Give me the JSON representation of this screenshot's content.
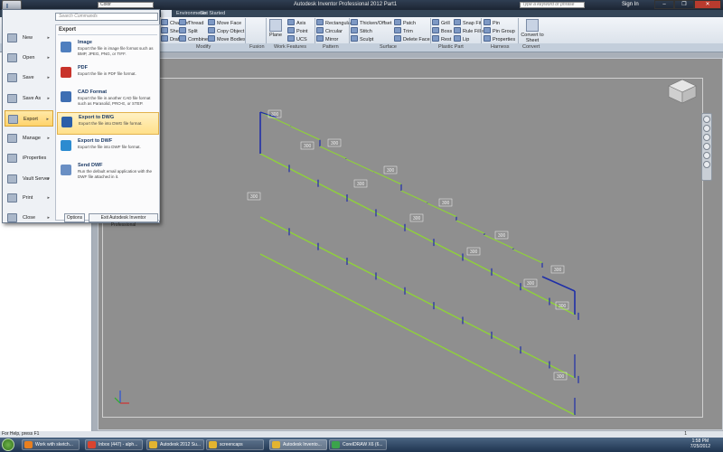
{
  "window": {
    "title": "Autodesk Inventor Professional 2012   Part1",
    "quick_access_combo": "Color",
    "search_placeholder": "Type a keyword or phrase",
    "sign_in": "Sign In"
  },
  "tabs": [
    {
      "label": "Environments"
    },
    {
      "label": "Get Started"
    }
  ],
  "ribbon": {
    "modify_tools": [
      "Chamfer",
      "Shell",
      "Draft",
      "Thread",
      "Split",
      "Combine",
      "Move Face",
      "Copy Object",
      "Move Bodies"
    ],
    "work_features": {
      "plane": "Plane",
      "axis": "Axis",
      "point": "Point",
      "ucs": "UCS"
    },
    "pattern_tools": [
      "Rectangular",
      "Circular",
      "Mirror"
    ],
    "surface_tools": [
      "Thicken/Offset",
      "Stitch",
      "Sculpt",
      "Patch",
      "Trim",
      "Delete Face"
    ],
    "plastic_tools": [
      "Grill",
      "Boss",
      "Rest",
      "Snap Fit",
      "Rule Fillet",
      "Lip"
    ],
    "harness_tools": [
      "Pin",
      "Pin Group",
      "Properties"
    ],
    "convert_tool": "Convert to Sheet Metal",
    "panels": [
      "Modify",
      "Fusion",
      "Work Features",
      "Pattern",
      "Surface",
      "Plastic Part",
      "Harness",
      "Convert"
    ]
  },
  "app_menu": {
    "search_placeholder": "Search Commands",
    "items": [
      {
        "label": "New",
        "arrow": "▸"
      },
      {
        "label": "Open",
        "arrow": "▸"
      },
      {
        "label": "Save",
        "arrow": "▸"
      },
      {
        "label": "Save As",
        "arrow": "▸"
      },
      {
        "label": "Export",
        "arrow": "▸"
      },
      {
        "label": "Manage",
        "arrow": "▸"
      },
      {
        "label": "iProperties",
        "arrow": ""
      },
      {
        "label": "Vault Server",
        "arrow": "▸"
      },
      {
        "label": "Print",
        "arrow": "▸"
      },
      {
        "label": "Close",
        "arrow": "▸"
      }
    ],
    "export_header": "Export",
    "export_items": [
      {
        "title": "Image",
        "desc": "Export the file in image file format such as BMP, JPEG, PNG, or TIFF.",
        "color": "#4f7fbf"
      },
      {
        "title": "PDF",
        "desc": "Export the file in PDF file format.",
        "color": "#c8332b"
      },
      {
        "title": "CAD Format",
        "desc": "Export the file in another CAD file format such as Parasolid, PRO-E, or STEP.",
        "color": "#3f6fb3"
      },
      {
        "title": "Export to DWG",
        "desc": "Export the file into DWG file format.",
        "color": "#2b5fa8"
      },
      {
        "title": "Export to DWF",
        "desc": "Export the file into DWF file format.",
        "color": "#2d8bd0"
      },
      {
        "title": "Send DWF",
        "desc": "Run the default email application with the DWF file attached in it.",
        "color": "#6a8fc4"
      }
    ],
    "options_label": "Options",
    "exit_label": "Exit Autodesk Inventor Professional"
  },
  "drawing": {
    "dims": [
      "300",
      "300",
      "300",
      "300",
      "300",
      "300",
      "300",
      "300",
      "300",
      "300",
      "300",
      "300",
      "300",
      "300",
      "300",
      "300",
      "300"
    ],
    "colors": {
      "green": "#8fd13a",
      "blue": "#1f2fa8",
      "dim": "#f2f2f2"
    }
  },
  "status": {
    "help": "For Help, press F1",
    "count": "1"
  },
  "taskbar": {
    "items": [
      {
        "label": "Work with sketch...",
        "color": "#e87f1f"
      },
      {
        "label": "Inbox (447) - alph...",
        "color": "#d9442f"
      },
      {
        "label": "Autodesk 2012 Su...",
        "color": "#e3b430"
      },
      {
        "label": "screencaps",
        "color": "#e3b430"
      },
      {
        "label": "Autodesk Invento...",
        "color": "#e3b430"
      },
      {
        "label": "CorelDRAW X6 (6...",
        "color": "#3ba34b"
      }
    ],
    "time": "1:58 PM",
    "date": "7/25/2012"
  }
}
